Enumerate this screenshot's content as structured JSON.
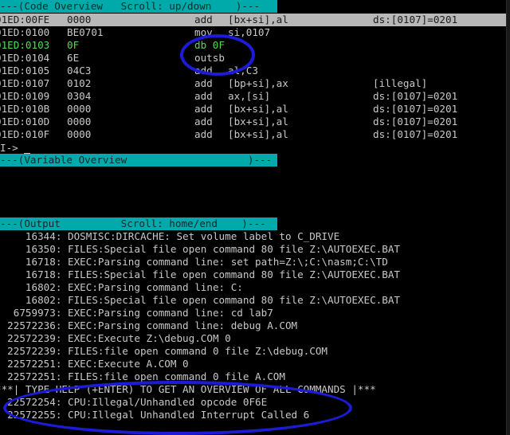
{
  "code_overview": {
    "header": "---(Code Overview   Scroll: up/down    )---",
    "rows": [
      {
        "addr": "01ED:00FE",
        "hex": "0000",
        "mn": "add",
        "ops": "[bx+si],al",
        "ext": "ds:[0107]=0201"
      },
      {
        "addr": "01ED:0100",
        "hex": "BE0701",
        "mn": "mov",
        "ops": "si,0107",
        "ext": ""
      },
      {
        "addr": "01ED:0103",
        "hex": "0F",
        "mn": "db 0F",
        "ops": "",
        "ext": ""
      },
      {
        "addr": "01ED:0104",
        "hex": "6E",
        "mn": "outsb",
        "ops": "",
        "ext": ""
      },
      {
        "addr": "01ED:0105",
        "hex": "04C3",
        "mn": "add",
        "ops": "al,C3",
        "ext": ""
      },
      {
        "addr": "01ED:0107",
        "hex": "0102",
        "mn": "add",
        "ops": "[bp+si],ax",
        "ext": "[illegal]"
      },
      {
        "addr": "01ED:0109",
        "hex": "0304",
        "mn": "add",
        "ops": "ax,[si]",
        "ext": "ds:[0107]=0201"
      },
      {
        "addr": "01ED:010B",
        "hex": "0000",
        "mn": "add",
        "ops": "[bx+si],al",
        "ext": "ds:[0107]=0201"
      },
      {
        "addr": "01ED:010D",
        "hex": "0000",
        "mn": "add",
        "ops": "[bx+si],al",
        "ext": "ds:[0107]=0201"
      },
      {
        "addr": "01ED:010F",
        "hex": "0000",
        "mn": "add",
        "ops": "[bx+si],al",
        "ext": "ds:[0107]=0201"
      }
    ],
    "prompt": "I->"
  },
  "variable_overview": {
    "header": "---(Variable Overview                    )---"
  },
  "output": {
    "header": "---(Output          Scroll: home/end    )---",
    "lines": [
      "     16344: DOSMISC:DIRCACHE: Set volume label to C_DRIVE",
      "     16350: FILES:Special file open command 80 file Z:\\AUTOEXEC.BAT",
      "     16718: EXEC:Parsing command line: set path=Z:\\;C:\\nasm;C:\\TD",
      "     16718: FILES:Special file open command 80 file Z:\\AUTOEXEC.BAT",
      "     16802: EXEC:Parsing command line: C:",
      "     16802: FILES:Special file open command 80 file Z:\\AUTOEXEC.BAT",
      "   6759973: EXEC:Parsing command line: cd lab7",
      "  22572236: EXEC:Parsing command line: debug A.COM",
      "  22572239: EXEC:Execute Z:\\debug.COM 0",
      "  22572239: FILES:file open command 0 file Z:\\debug.COM",
      "  22572251: EXEC:Execute A.COM 0",
      "  22572251: FILES:file open command 0 file A.COM",
      "***| TYPE HELP (+ENTER) TO GET AN OVERVIEW OF ALL COMMANDS |***",
      "  22572254: CPU:Illegal/Unhandled opcode 0F6E",
      "  22572255: CPU:Illegal Unhandled Interrupt Called 6"
    ]
  },
  "colors": {
    "header_bar": "#00aaaa",
    "selected_row": "#b8b8b8",
    "highlight_text": "#55d955",
    "annotation": "#1b1bd8"
  }
}
